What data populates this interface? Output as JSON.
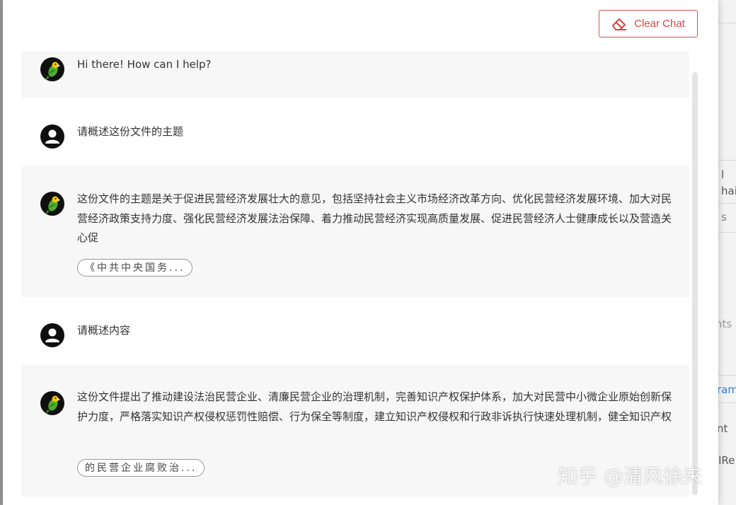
{
  "header": {
    "clear_chat_label": "Clear Chat"
  },
  "messages": [
    {
      "role": "bot",
      "text": "Hi there! How can I help?"
    },
    {
      "role": "user",
      "text": "请概述这份文件的主题"
    },
    {
      "role": "bot",
      "text": "这份文件的主题是关于促进民营经济发展壮大的意见，包括坚持社会主义市场经济改革方向、优化民营经济发展环境、加大对民营经济政策支持力度、强化民营经济发展法治保障、着力推动民营经济实现高质量发展、促进民营经济人士健康成长以及营造关心促",
      "source_chip": "《中共中央国务..."
    },
    {
      "role": "user",
      "text": "请概述内容"
    },
    {
      "role": "bot",
      "text": "这份文件提出了推动建设法治民营企业、清廉民营企业的治理机制，完善知识产权保护体系，加大对民营中小微企业原始创新保护力度，严格落实知识产权侵权惩罚性赔偿、行为保全等制度，建立知识产权侵权和行政非诉执行快速处理机制，健全知识产权",
      "source_chip": "的民营企业腐败治..."
    }
  ],
  "background_fragments": [
    "l",
    "hai",
    "s",
    "nts",
    "ram",
    "nt",
    "alRe"
  ],
  "watermark": "知乎 @清风徐来",
  "colors": {
    "accent": "#d64541",
    "bot_bg": "#f7f7f7",
    "avatar_bg": "#0f0f0f"
  },
  "icons": {
    "clear": "eraser-icon",
    "bot_avatar": "parrot-icon",
    "user_avatar": "person-icon"
  }
}
